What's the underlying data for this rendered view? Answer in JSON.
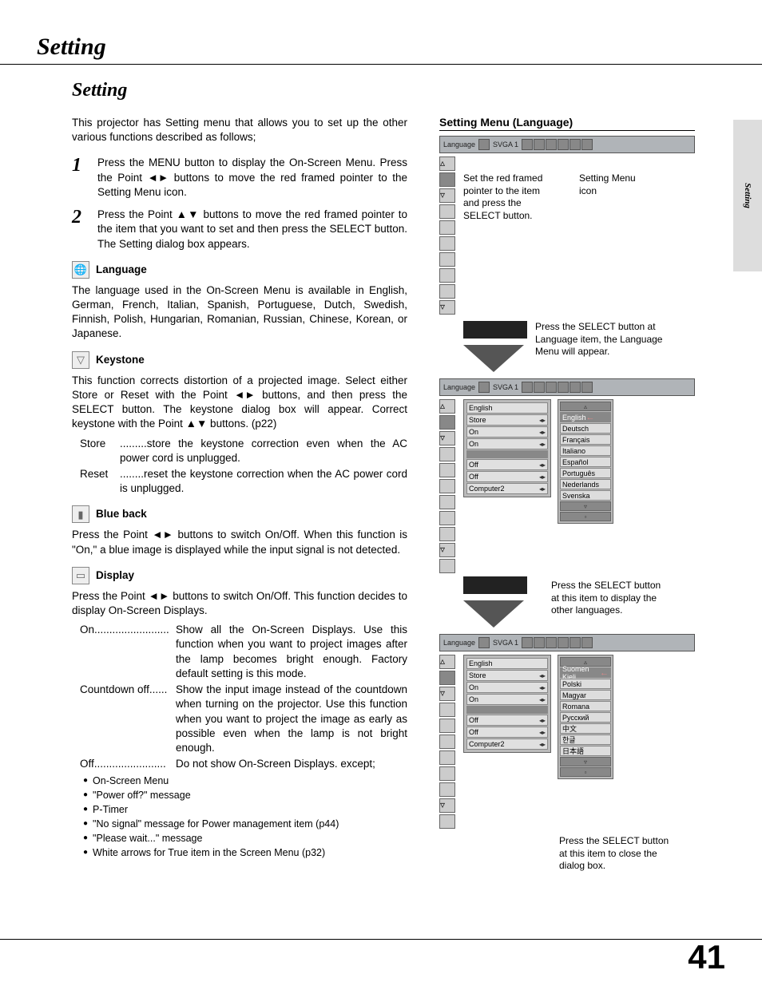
{
  "page": {
    "header_title": "Setting",
    "side_tab": "Setting",
    "page_number": "41"
  },
  "left": {
    "section_title": "Setting",
    "intro": "This projector has Setting menu that allows you to set up the other various functions described as follows;",
    "steps": [
      {
        "num": "1",
        "body": "Press the MENU button to display the On-Screen Menu.  Press the Point ◄► buttons to move the red framed pointer to the Setting Menu icon."
      },
      {
        "num": "2",
        "body": "Press the Point ▲▼ buttons to move the red framed pointer to the item that you want to set and then press the SELECT button.  The Setting dialog box appears."
      }
    ],
    "items": [
      {
        "icon": "🌐",
        "label": "Language",
        "paragraphs": [
          "The language used in the On-Screen Menu is available in English, German, French, Italian, Spanish, Portuguese, Dutch, Swedish, Finnish, Polish, Hungarian, Romanian, Russian, Chinese, Korean, or Japanese."
        ]
      },
      {
        "icon": "▽",
        "label": "Keystone",
        "paragraphs": [
          "This function corrects distortion of a projected image.  Select either Store or Reset with the Point ◄► buttons, and then press the SELECT button.  The keystone dialog box will appear.  Correct keystone with the Point ▲▼ buttons. (p22)"
        ],
        "defs": [
          {
            "term": "Store",
            "body": ".........store the keystone correction even when the AC power cord is unplugged."
          },
          {
            "term": "Reset",
            "body": "........reset the keystone correction when the AC power cord is unplugged."
          }
        ]
      },
      {
        "icon": "▮",
        "label": "Blue back",
        "paragraphs": [
          "Press the Point ◄► buttons to switch On/Off.  When this function is \"On,\" a blue image is displayed while the input signal is not detected."
        ]
      },
      {
        "icon": "▭",
        "label": "Display",
        "paragraphs": [
          "Press the Point ◄► buttons to switch On/Off.  This function decides to display On-Screen Displays."
        ],
        "defs2": [
          {
            "term": "On",
            "dots": ".........................",
            "body": "Show all the On-Screen Displays.  Use this function when you want to project images after the lamp becomes bright enough.  Factory default setting is this mode."
          },
          {
            "term": "Countdown off",
            "dots": "......",
            "body": "Show the input image instead of the countdown when turning on the projector.  Use this function when you want to project the image as early as possible even when the lamp is not bright enough."
          },
          {
            "term": "Off",
            "dots": "........................",
            "body": "Do not show On-Screen Displays. except;"
          }
        ],
        "bullets": [
          "On-Screen Menu",
          "\"Power off?\" message",
          "P-Timer",
          "\"No signal\" message for Power management item (p44)",
          "\"Please wait...\" message",
          "White arrows for True item in the Screen Menu (p32)"
        ]
      }
    ]
  },
  "right": {
    "title": "Setting Menu (Language)",
    "menubar_label": "Language",
    "menubar_mode": "SVGA 1",
    "cap1": "Set the red framed pointer to the item and press the SELECT button.",
    "cap2": "Setting Menu icon",
    "cap3": "Press the SELECT button at Language item, the Language Menu will appear.",
    "cap4": "Press the SELECT button at this item to display the other languages.",
    "cap5": "Press the SELECT button at this item to close the dialog box.",
    "panel_rows": [
      "English",
      "Store",
      "On",
      "On",
      "",
      "Off",
      "Off",
      "Computer2"
    ],
    "langs1": [
      "English",
      "Deutsch",
      "Français",
      "Italiano",
      "Español",
      "Português",
      "Nederlands",
      "Svenska"
    ],
    "langs2": [
      "Suomen Kieli",
      "Polski",
      "Magyar",
      "Romana",
      "Русский",
      "中文",
      "한글",
      "日本語"
    ]
  }
}
